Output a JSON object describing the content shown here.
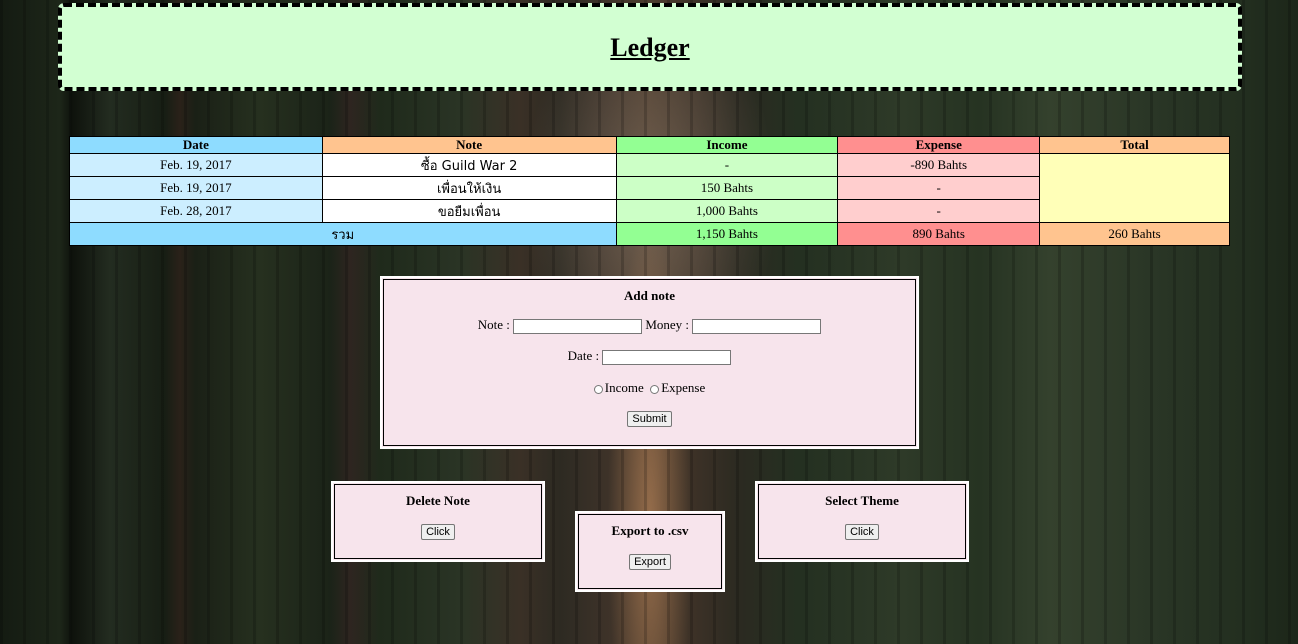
{
  "header": {
    "title": "Ledger"
  },
  "table": {
    "headers": {
      "date": "Date",
      "note": "Note",
      "income": "Income",
      "expense": "Expense",
      "total": "Total"
    },
    "rows": [
      {
        "date": "Feb. 19, 2017",
        "note": "ซื้อ Guild War 2",
        "income": "-",
        "expense": "-890 Bahts"
      },
      {
        "date": "Feb. 19, 2017",
        "note": "เพื่อนให้เงิน",
        "income": "150 Bahts",
        "expense": "-"
      },
      {
        "date": "Feb. 28, 2017",
        "note": "ขอยืมเพื่อน",
        "income": "1,000 Bahts",
        "expense": "-"
      }
    ],
    "summary": {
      "label": "รวม",
      "income": "1,150 Bahts",
      "expense": "890 Bahts",
      "total": "260 Bahts"
    }
  },
  "add_note": {
    "title": "Add note",
    "note_label": "Note :",
    "note_value": "",
    "money_label": "Money :",
    "money_value": "",
    "date_label": "Date :",
    "date_value": "",
    "income_label": "Income",
    "expense_label": "Expense",
    "submit_label": "Submit"
  },
  "delete_note": {
    "title": "Delete Note",
    "button_label": "Click"
  },
  "export": {
    "title": "Export to .csv",
    "button_label": "Export"
  },
  "select_theme": {
    "title": "Select Theme",
    "button_label": "Click"
  },
  "colors": {
    "header_bg": "#d2ffd2",
    "date_header": "#8edcff",
    "note_header": "#ffc48f",
    "income_header": "#93ff93",
    "expense_header": "#ff8f8f",
    "total_header": "#ffc48f",
    "panel_bg": "#f7e4ec"
  }
}
